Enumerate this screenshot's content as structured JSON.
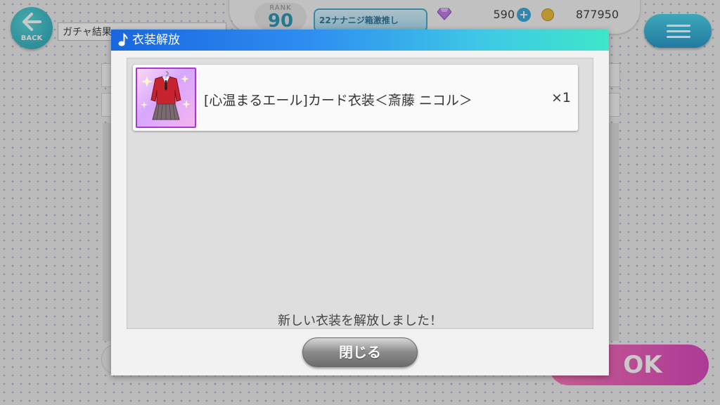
{
  "header": {
    "back_label": "BACK",
    "screen_title": "ガチャ結果",
    "rank_label": "RANK",
    "rank_value": "90",
    "event_banner": "22ナナニジ箱激推し",
    "gems": "590",
    "coins": "877950"
  },
  "background": {
    "ok_label": "OK"
  },
  "modal": {
    "title": "衣装解放",
    "items": [
      {
        "name": "[心温まるエール]カード衣装＜斎藤 ニコル＞",
        "quantity": "×1",
        "icon": "costume-thumbnail"
      }
    ],
    "message": "新しい衣装を解放しました！",
    "close_label": "閉じる"
  },
  "colors": {
    "header_gradient_start": "#1a66e0",
    "header_gradient_end": "#3ee6c9",
    "accent_teal": "#1a9fb0",
    "ok_pink": "#e24ab6"
  }
}
